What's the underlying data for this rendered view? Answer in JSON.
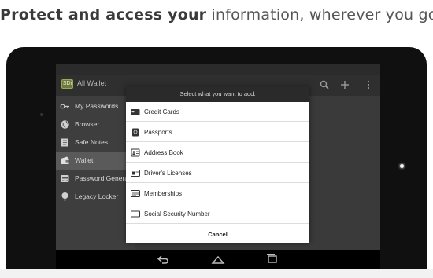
{
  "headline": {
    "bold": "Protect and access your",
    "light": "information, wherever you go"
  },
  "actionbar": {
    "app_icon_text": "SDi",
    "title": "All Wallet",
    "icons": [
      "search-icon",
      "add-icon",
      "overflow-menu-icon"
    ]
  },
  "sidebar": {
    "items": [
      {
        "label": "My Passwords",
        "icon": "key-icon"
      },
      {
        "label": "Browser",
        "icon": "globe-icon"
      },
      {
        "label": "Safe Notes",
        "icon": "note-icon"
      },
      {
        "label": "Wallet",
        "icon": "wallet-icon",
        "active": true
      },
      {
        "label": "Password Generat",
        "icon": "generator-icon"
      },
      {
        "label": "Legacy Locker",
        "icon": "tree-icon"
      }
    ]
  },
  "dialog": {
    "title": "Select what you want to add:",
    "items": [
      {
        "label": "Credit Cards",
        "icon": "credit-card-icon"
      },
      {
        "label": "Passports",
        "icon": "passport-icon"
      },
      {
        "label": "Address Book",
        "icon": "address-book-icon"
      },
      {
        "label": "Driver's Licenses",
        "icon": "drivers-license-icon"
      },
      {
        "label": "Memberships",
        "icon": "membership-icon"
      },
      {
        "label": "Social Security Number",
        "icon": "ssn-card-icon"
      }
    ],
    "cancel": "Cancel"
  },
  "system_nav": {
    "icons": [
      "back-icon",
      "home-icon",
      "recent-apps-icon"
    ]
  },
  "colors": {
    "tablet_bezel": "#101010",
    "sidebar_bg": "#3e3e3e",
    "active_item": "#5a5a5a",
    "dialog_header": "#2a2a2a"
  }
}
